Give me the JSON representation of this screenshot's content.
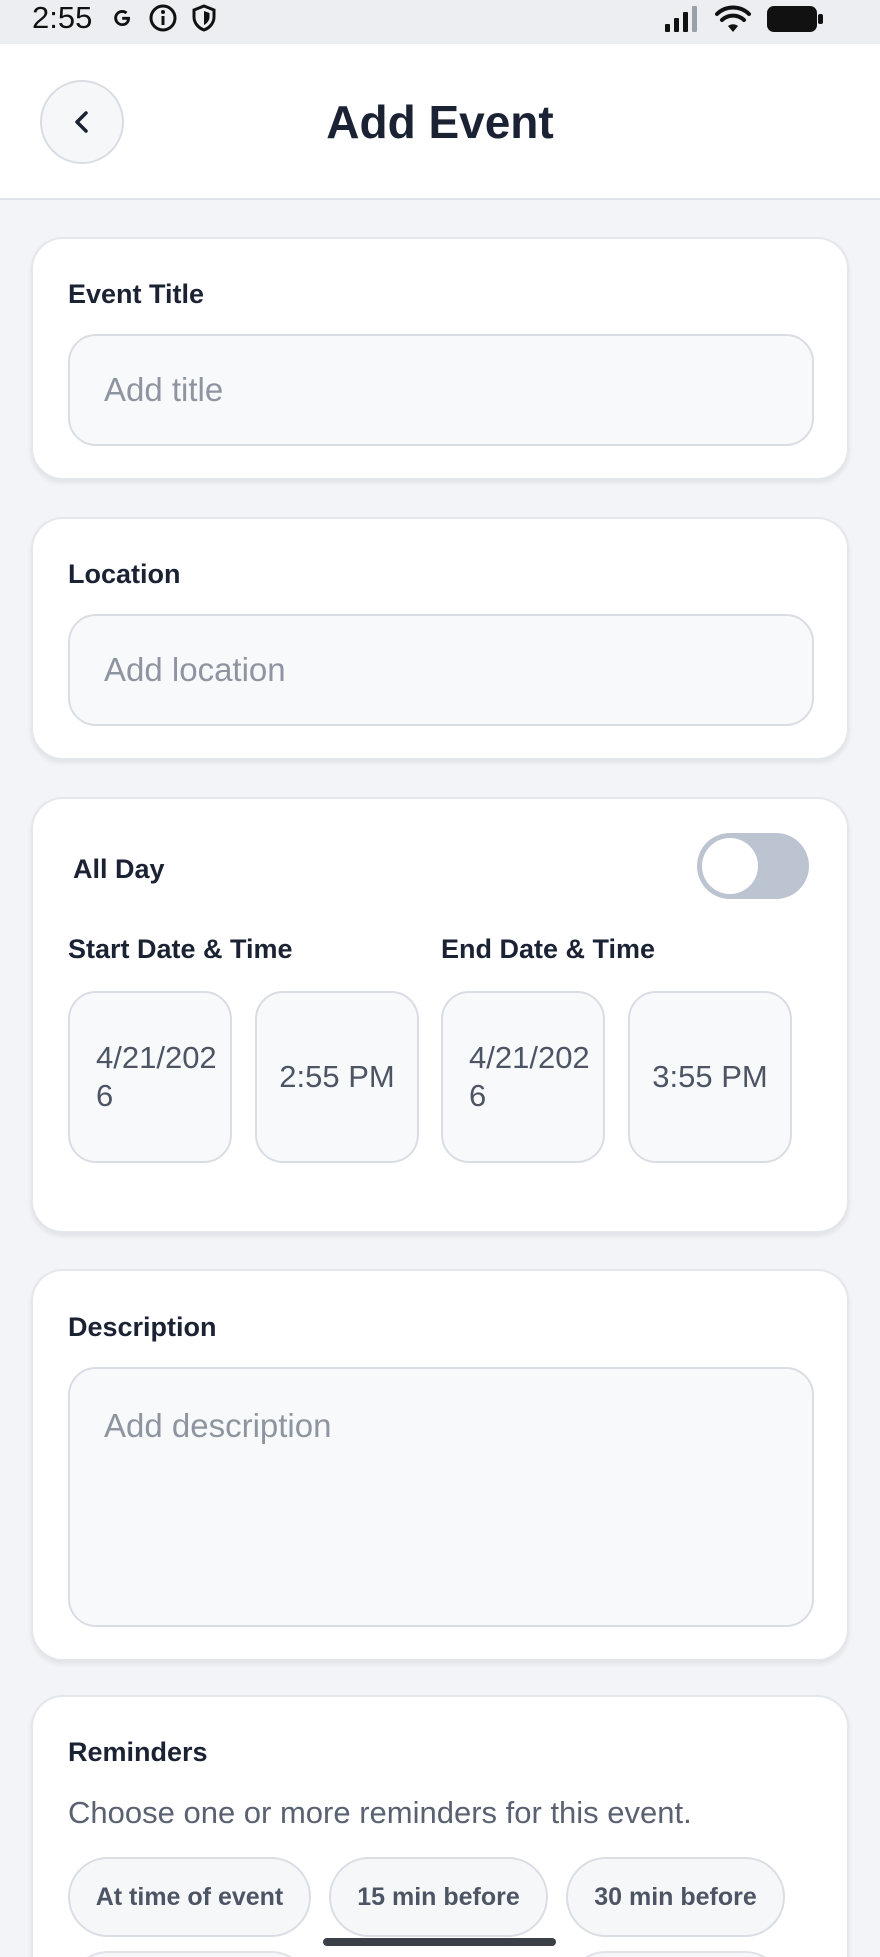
{
  "status_bar": {
    "time": "2:55",
    "left_icons": [
      "google-icon",
      "info-icon",
      "shield-icon"
    ],
    "right_icons": [
      "signal-icon",
      "wifi-icon",
      "battery-icon"
    ]
  },
  "header": {
    "title": "Add Event",
    "back_icon": "chevron-left-icon"
  },
  "event_title": {
    "label": "Event Title",
    "placeholder": "Add title",
    "value": ""
  },
  "location": {
    "label": "Location",
    "placeholder": "Add location",
    "value": ""
  },
  "schedule": {
    "all_day_label": "All Day",
    "all_day_on": false,
    "start_label": "Start Date & Time",
    "end_label": "End Date & Time",
    "start_date": "4/21/2026",
    "start_time": "2:55 PM",
    "end_date": "4/21/2026",
    "end_time": "3:55 PM"
  },
  "description": {
    "label": "Description",
    "placeholder": "Add description",
    "value": ""
  },
  "reminders": {
    "label": "Reminders",
    "helper": "Choose one or more reminders for this event.",
    "options": [
      "At time of event",
      "15 min before",
      "30 min before"
    ]
  },
  "colors": {
    "accent_text": "#1a2233",
    "toggle_off": "#bcc4d1",
    "card_border": "#e3e6eb",
    "background": "#f3f4f7"
  }
}
